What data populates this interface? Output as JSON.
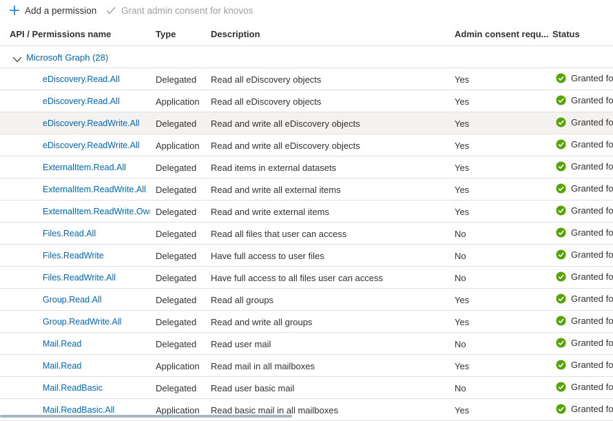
{
  "toolbar": {
    "add_label": "Add a permission",
    "add_icon": "plus-icon",
    "grant_label": "Grant admin consent for knovos",
    "grant_icon": "checkmark-icon"
  },
  "columns": {
    "name": "API / Permissions name",
    "type": "Type",
    "description": "Description",
    "admin": "Admin consent requ...",
    "status": "Status"
  },
  "group": {
    "label": "Microsoft Graph (28)",
    "icon": "chevron-down-icon"
  },
  "colors": {
    "link": "#0067b8",
    "granted": "#57a300",
    "selected_row": "#f3f2f1"
  },
  "rows": [
    {
      "name": "eDiscovery.Read.All",
      "type": "Delegated",
      "description": "Read all eDiscovery objects",
      "admin": "Yes",
      "status": "Granted for"
    },
    {
      "name": "eDiscovery.Read.All",
      "type": "Application",
      "description": "Read all eDiscovery objects",
      "admin": "Yes",
      "status": "Granted for"
    },
    {
      "name": "eDiscovery.ReadWrite.All",
      "type": "Delegated",
      "description": "Read and write all eDiscovery objects",
      "admin": "Yes",
      "status": "Granted for"
    },
    {
      "name": "eDiscovery.ReadWrite.All",
      "type": "Application",
      "description": "Read and write all eDiscovery objects",
      "admin": "Yes",
      "status": "Granted for"
    },
    {
      "name": "ExternalItem.Read.All",
      "type": "Delegated",
      "description": "Read items in external datasets",
      "admin": "Yes",
      "status": "Granted for"
    },
    {
      "name": "ExternalItem.ReadWrite.All",
      "type": "Delegated",
      "description": "Read and write all external items",
      "admin": "Yes",
      "status": "Granted for"
    },
    {
      "name": "ExternalItem.ReadWrite.Owne",
      "type": "Delegated",
      "description": "Read and write external items",
      "admin": "Yes",
      "status": "Granted for"
    },
    {
      "name": "Files.Read.All",
      "type": "Delegated",
      "description": "Read all files that user can access",
      "admin": "No",
      "status": "Granted for"
    },
    {
      "name": "Files.ReadWrite",
      "type": "Delegated",
      "description": "Have full access to user files",
      "admin": "No",
      "status": "Granted for"
    },
    {
      "name": "Files.ReadWrite.All",
      "type": "Delegated",
      "description": "Have full access to all files user can access",
      "admin": "No",
      "status": "Granted for"
    },
    {
      "name": "Group.Read.All",
      "type": "Delegated",
      "description": "Read all groups",
      "admin": "Yes",
      "status": "Granted for"
    },
    {
      "name": "Group.ReadWrite.All",
      "type": "Delegated",
      "description": "Read and write all groups",
      "admin": "Yes",
      "status": "Granted for"
    },
    {
      "name": "Mail.Read",
      "type": "Delegated",
      "description": "Read user mail",
      "admin": "No",
      "status": "Granted for"
    },
    {
      "name": "Mail.Read",
      "type": "Application",
      "description": "Read mail in all mailboxes",
      "admin": "Yes",
      "status": "Granted for"
    },
    {
      "name": "Mail.ReadBasic",
      "type": "Delegated",
      "description": "Read user basic mail",
      "admin": "No",
      "status": "Granted for"
    },
    {
      "name": "Mail.ReadBasic.All",
      "type": "Application",
      "description": "Read basic mail in all mailboxes",
      "admin": "Yes",
      "status": "Granted for"
    }
  ]
}
